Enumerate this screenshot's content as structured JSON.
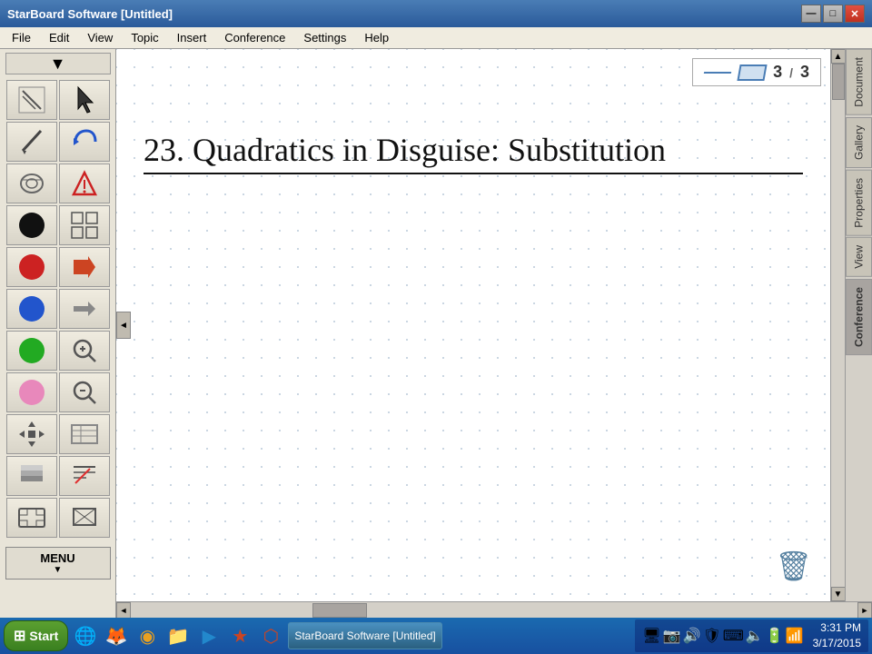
{
  "titlebar": {
    "title": "StarBoard Software [Untitled]",
    "min_label": "—",
    "max_label": "□",
    "close_label": "✕"
  },
  "menubar": {
    "items": [
      "File",
      "Edit",
      "View",
      "Topic",
      "Insert",
      "Topic",
      "Conference",
      "Settings",
      "Help"
    ]
  },
  "toolbar": {
    "dropdown_label": "▼",
    "menu_label": "MENU",
    "menu_arrow": "▼"
  },
  "canvas": {
    "title": "23.  Quadratics in Disguise: Substitution"
  },
  "page_indicator": {
    "current": "3",
    "total": "3",
    "separator": "/"
  },
  "right_tabs": {
    "items": [
      "Document",
      "Gallery",
      "Properties",
      "View",
      "Conference"
    ]
  },
  "bottom_toolbar": {
    "pen_icon": "✒",
    "eraser_icon": "◻",
    "circle_icon": "○"
  },
  "taskbar": {
    "start_label": "Start",
    "open_window_label": "StarBoard Software [Untitled]",
    "clock_time": "3:31 PM",
    "clock_date": "3/17/2015"
  },
  "tray_icons": [
    "🔊",
    "🌐",
    "🔋"
  ],
  "scroll": {
    "up_arrow": "▲",
    "down_arrow": "▼",
    "left_arrow": "◄",
    "right_arrow": "►"
  }
}
